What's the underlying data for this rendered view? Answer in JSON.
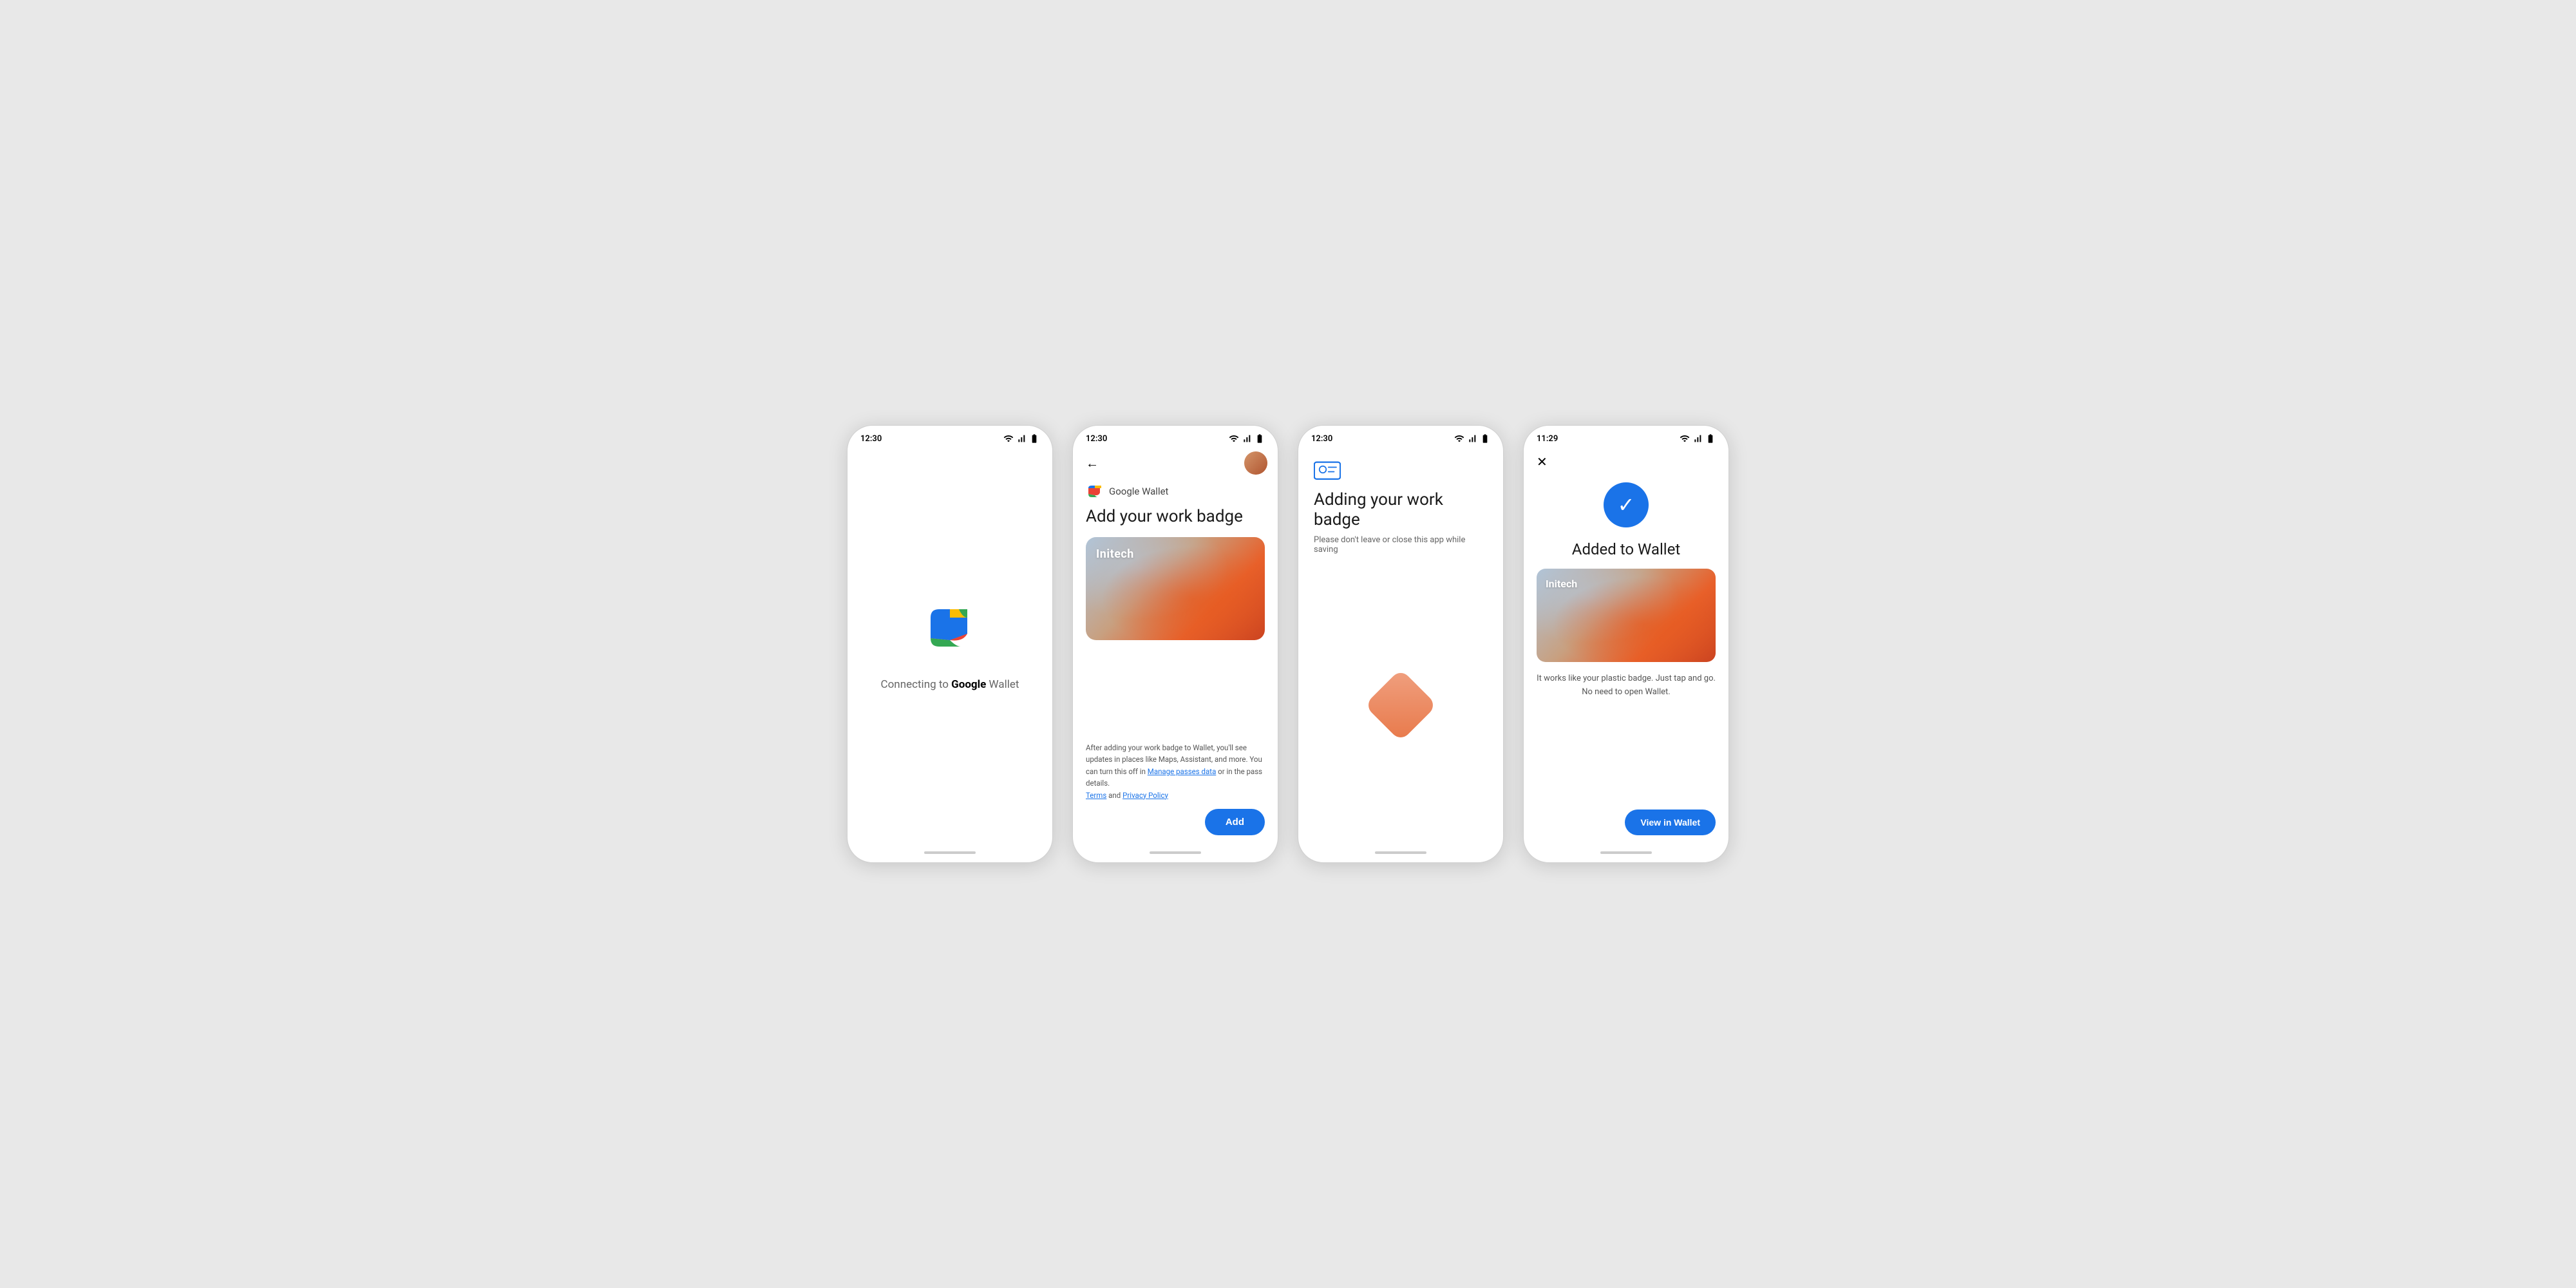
{
  "screen1": {
    "time": "12:30",
    "connecting_text_prefix": "Connecting to ",
    "connecting_text_brand": "Google",
    "connecting_text_suffix": " Wallet"
  },
  "screen2": {
    "time": "12:30",
    "google_wallet_label": "Google Wallet",
    "title": "Add your work badge",
    "badge_name": "Initech",
    "footer_text": "After adding your work badge to Wallet, you'll see updates in places like Maps, Assistant, and more. You can turn this off in ",
    "footer_link1": "Manage passes data",
    "footer_mid": " or in the pass details.",
    "footer_text2": " and ",
    "terms_link": "Terms",
    "privacy_link": "Privacy Policy",
    "add_button": "Add"
  },
  "screen3": {
    "time": "12:30",
    "title": "Adding your work badge",
    "subtitle": "Please don't leave or close this app while saving"
  },
  "screen4": {
    "time": "11:29",
    "title": "Added to Wallet",
    "badge_name": "Initech",
    "description": "It works like your plastic badge. Just tap and go.\nNo need to open Wallet.",
    "view_button": "View in Wallet"
  }
}
